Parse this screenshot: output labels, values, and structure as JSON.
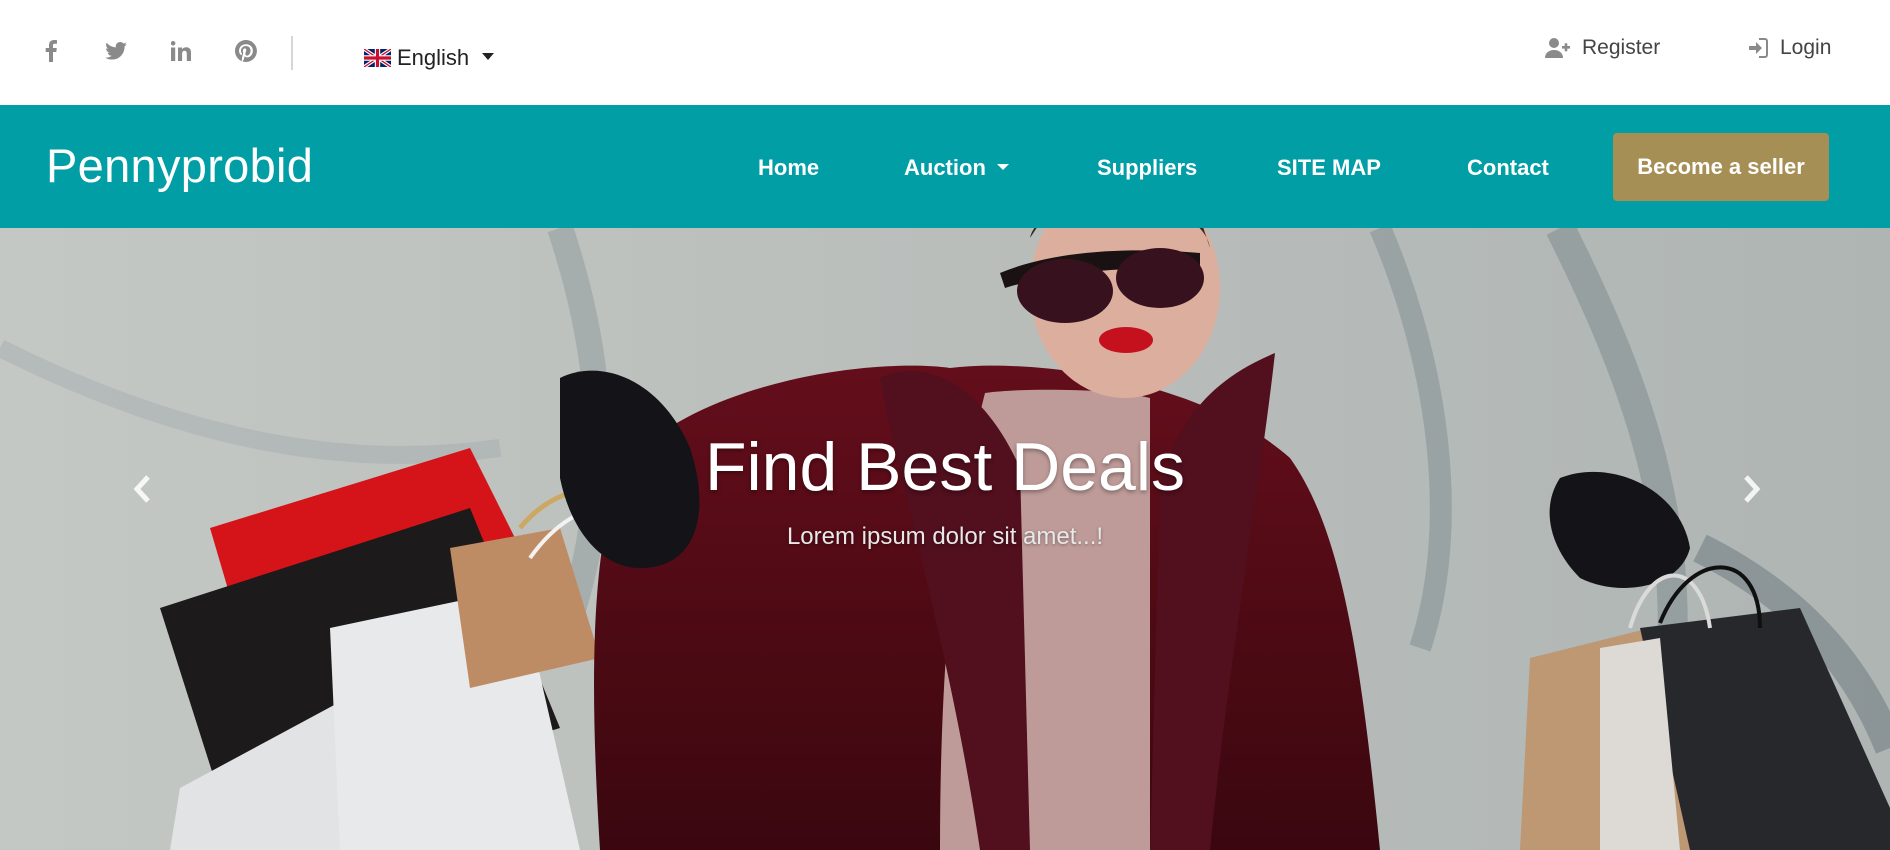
{
  "topbar": {
    "social": [
      "facebook-icon",
      "twitter-icon",
      "linkedin-icon",
      "pinterest-icon"
    ],
    "language": "English",
    "register_label": "Register",
    "login_label": "Login"
  },
  "navbar": {
    "brand": "Pennyprobid",
    "items": [
      "Home",
      "Auction",
      "Suppliers",
      "SITE MAP",
      "Contact"
    ],
    "cta_label": "Become a seller"
  },
  "hero": {
    "title": "Find Best Deals",
    "subtitle": "Lorem ipsum dolor sit amet...!"
  },
  "colors": {
    "nav_bg": "#029ea5",
    "cta_bg": "#a68f54",
    "icon_gray": "#8a8a8a"
  }
}
